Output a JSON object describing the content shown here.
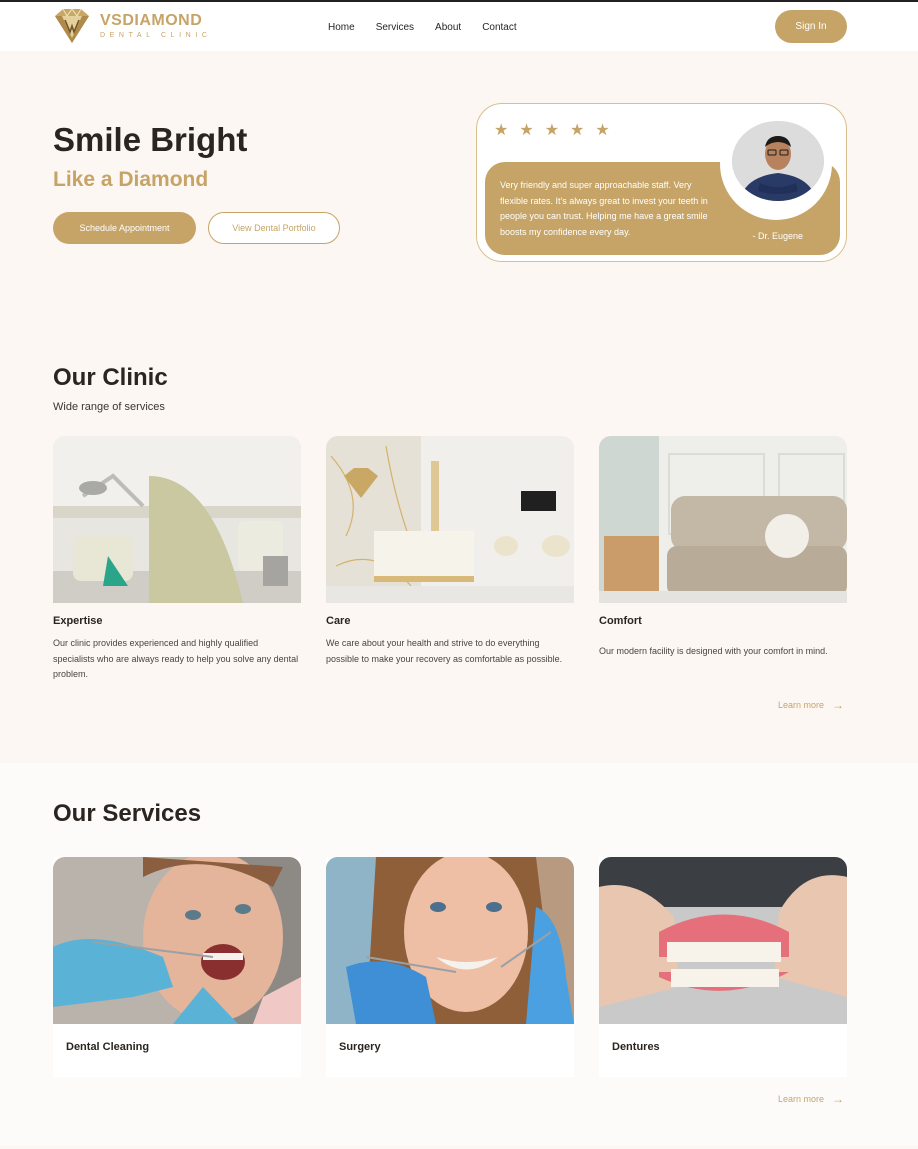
{
  "header": {
    "brand_name": "VSDIAMOND",
    "brand_sub": "DENTAL CLINIC",
    "nav": [
      "Home",
      "Services",
      "About",
      "Contact"
    ],
    "signin_label": "Sign In"
  },
  "hero": {
    "title": "Smile Bright",
    "subtitle": "Like a Diamond",
    "primary_button": "Schedule Appointment",
    "secondary_button": "View Dental Portfolio"
  },
  "testimonial": {
    "rating": 5,
    "stars": [
      "★",
      "★",
      "★",
      "★",
      "★"
    ],
    "quote": "Very friendly and super approachable staff. Very flexible rates. It's always great to invest your teeth in people you can trust. Helping me have a great smile boosts my confidence every day.",
    "author": "- Dr. Eugene"
  },
  "clinic": {
    "title": "Our Clinic",
    "subtitle": "Wide range of services",
    "cards": [
      {
        "title": "Expertise",
        "desc": "Our clinic provides experienced and highly qualified specialists who are always ready to help you solve any dental problem."
      },
      {
        "title": "Care",
        "desc": "We care about your health and strive to do everything possible to make your recovery as comfortable as possible."
      },
      {
        "title": "Comfort",
        "desc": "Our modern facility is designed with your comfort in mind."
      }
    ],
    "learn_more": "Learn more"
  },
  "services": {
    "title": "Our Services",
    "items": [
      "Dental Cleaning",
      "Surgery",
      "Dentures"
    ],
    "learn_more": "Learn more"
  },
  "colors": {
    "accent": "#c6a467",
    "background": "#fdf7f3",
    "text": "#2a2521"
  }
}
